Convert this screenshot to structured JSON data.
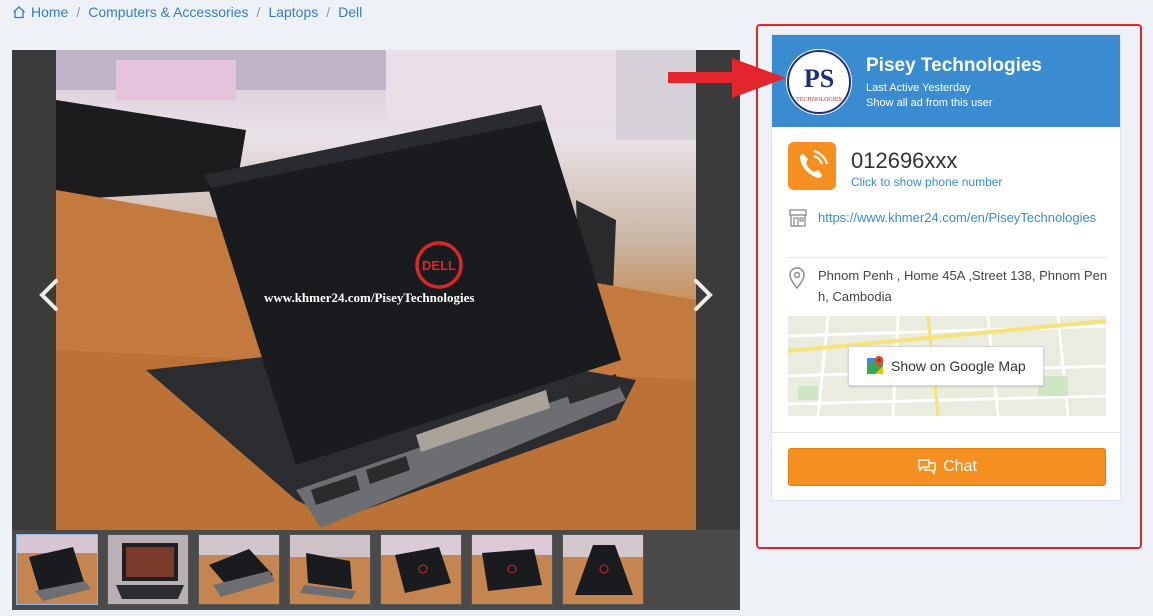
{
  "breadcrumb": {
    "items": [
      "Home",
      "Computers & Accessories",
      "Laptops",
      "Dell"
    ],
    "separator": "/"
  },
  "gallery": {
    "watermark": "www.khmer24.com/PiseyTechnologies",
    "logo_text": "DELL",
    "thumbnail_count": 7,
    "active_thumbnail": 1
  },
  "seller": {
    "name": "Pisey Technologies",
    "last_active": "Last Active Yesterday",
    "show_all_link": "Show all ad from this user",
    "logo_initials": "PS",
    "logo_subtext": "TECHNOLOGIES"
  },
  "contact": {
    "phone": "012696xxx",
    "phone_hint": "Click to show phone number",
    "store_url": "https://www.khmer24.com/en/PiseyTechnologies",
    "address": "Phnom Penh , Home 45A ,Street 138, Phnom Penh, Cambodia"
  },
  "map": {
    "button_label": "Show on Google Map"
  },
  "chat": {
    "label": "Chat"
  },
  "colors": {
    "accent_blue": "#3a8bd0",
    "orange": "#f58f1f",
    "highlight_red": "#e3262d"
  }
}
